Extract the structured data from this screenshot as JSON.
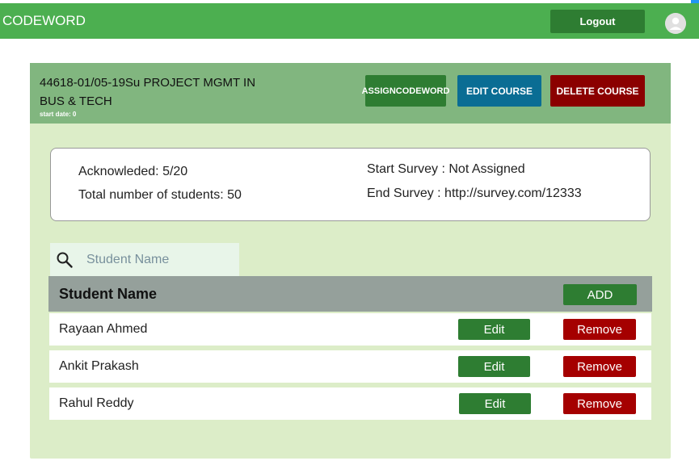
{
  "app": {
    "brand": "CODEWORD",
    "logout_label": "Logout"
  },
  "course": {
    "title": "44618-01/05-19Su PROJECT MGMT IN BUS & TECH",
    "start_date": "start date: 0",
    "assign_label_1": "ASSIGN",
    "assign_label_2": "CODEWORD",
    "edit_label": "EDIT COURSE",
    "delete_label": "DELETE COURSE"
  },
  "stats": {
    "acknowledged": "Acknowleded: 5/20",
    "total_students": "Total number of students: 50",
    "start_survey": "Start Survey : Not Assigned",
    "end_survey": "End Survey : http://survey.com/12333"
  },
  "search": {
    "placeholder": "Student Name",
    "value": ""
  },
  "table": {
    "header": "Student Name",
    "add_label": "ADD",
    "rows": [
      {
        "name": "Rayaan Ahmed",
        "edit_label": "Edit",
        "remove_label": "Remove"
      },
      {
        "name": "Ankit Prakash",
        "edit_label": "Edit",
        "remove_label": "Remove"
      },
      {
        "name": "Rahul Reddy",
        "edit_label": "Edit",
        "remove_label": "Remove"
      }
    ]
  },
  "colors": {
    "primary_green": "#4caf50",
    "dark_green": "#2e7d32",
    "header_green": "#81b67f",
    "card_bg": "#dcedc8",
    "edit_blue": "#0a6d94",
    "delete_red": "#8b0000",
    "remove_red": "#a50000"
  },
  "icons": {
    "avatar": "user-avatar-icon",
    "search": "search-icon"
  }
}
